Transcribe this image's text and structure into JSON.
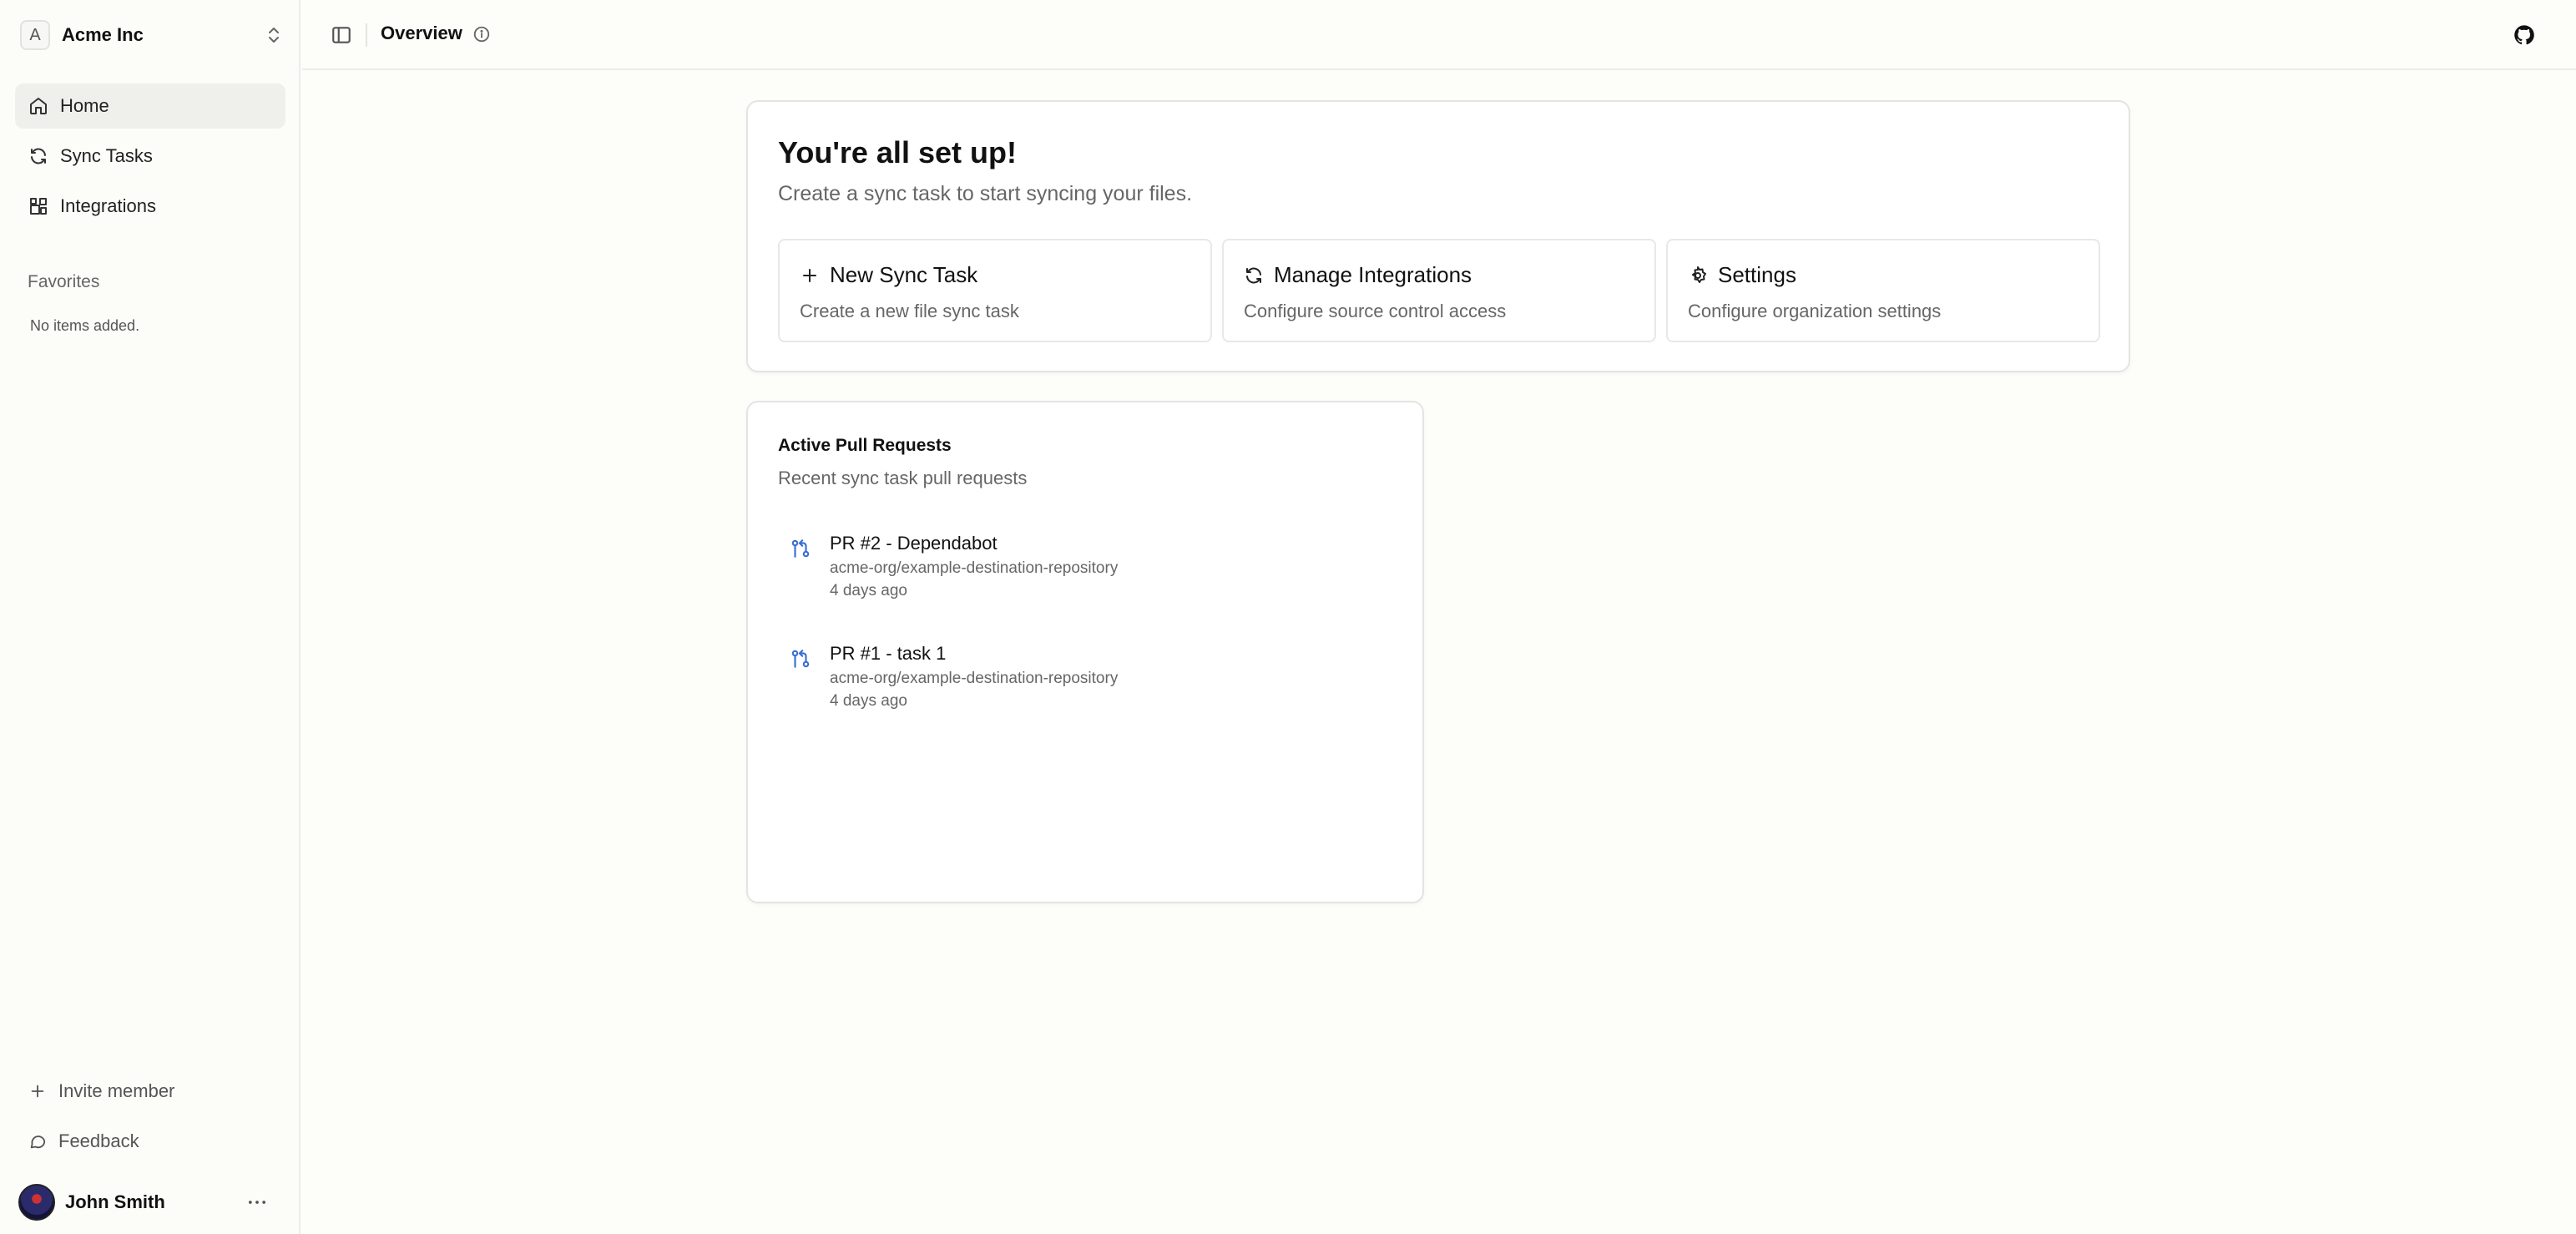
{
  "org": {
    "initial": "A",
    "name": "Acme Inc"
  },
  "sidebar": {
    "items": [
      {
        "label": "Home",
        "icon": "home-icon",
        "active": true
      },
      {
        "label": "Sync Tasks",
        "icon": "refresh-icon",
        "active": false
      },
      {
        "label": "Integrations",
        "icon": "blocks-icon",
        "active": false
      }
    ],
    "favorites_title": "Favorites",
    "favorites_empty": "No items added.",
    "invite_label": "Invite member",
    "feedback_label": "Feedback"
  },
  "user": {
    "name": "John Smith"
  },
  "header": {
    "title": "Overview"
  },
  "setup": {
    "title": "You're all set up!",
    "subtitle": "Create a sync task to start syncing your files.",
    "actions": [
      {
        "title": "New Sync Task",
        "description": "Create a new file sync task",
        "icon": "plus-icon"
      },
      {
        "title": "Manage Integrations",
        "description": "Configure source control access",
        "icon": "refresh-icon"
      },
      {
        "title": "Settings",
        "description": "Configure organization settings",
        "icon": "gear-icon"
      }
    ]
  },
  "pull_requests": {
    "title": "Active Pull Requests",
    "subtitle": "Recent sync task pull requests",
    "items": [
      {
        "title": "PR #2 - Dependabot",
        "repo": "acme-org/example-destination-repository",
        "time": "4 days ago"
      },
      {
        "title": "PR #1 - task 1",
        "repo": "acme-org/example-destination-repository",
        "time": "4 days ago"
      }
    ]
  },
  "colors": {
    "accent": "#3b6fd4",
    "background": "#fdfdfa",
    "active_nav": "#efefec"
  }
}
